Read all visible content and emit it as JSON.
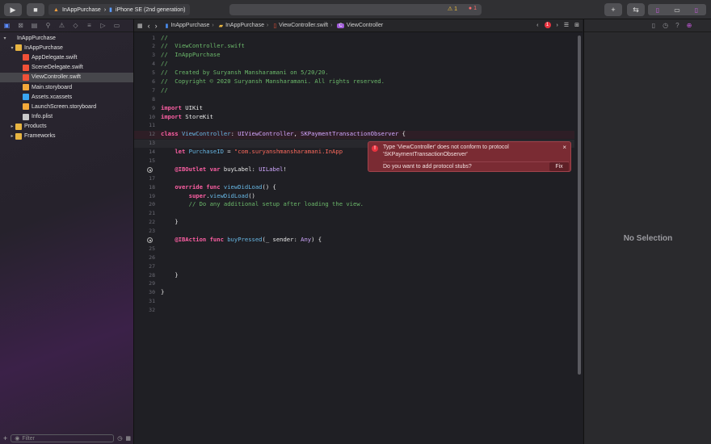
{
  "toolbar": {
    "run_icon": "play-icon",
    "stop_icon": "stop-icon",
    "scheme": "InAppPurchase",
    "device": "iPhone SE (2nd generation)",
    "warnings": "1",
    "errors": "1"
  },
  "navigator": {
    "items": [
      {
        "label": "InAppPurchase",
        "icon": "project",
        "depth": 0,
        "disclosure": "▾"
      },
      {
        "label": "InAppPurchase",
        "icon": "folder",
        "depth": 1,
        "disclosure": "▾"
      },
      {
        "label": "AppDelegate.swift",
        "icon": "swift",
        "depth": 2
      },
      {
        "label": "SceneDelegate.swift",
        "icon": "swift",
        "depth": 2
      },
      {
        "label": "ViewController.swift",
        "icon": "swift",
        "depth": 2,
        "selected": true
      },
      {
        "label": "Main.storyboard",
        "icon": "story",
        "depth": 2
      },
      {
        "label": "Assets.xcassets",
        "icon": "assets",
        "depth": 2
      },
      {
        "label": "LaunchScreen.storyboard",
        "icon": "story",
        "depth": 2
      },
      {
        "label": "Info.plist",
        "icon": "plist",
        "depth": 2
      },
      {
        "label": "Products",
        "icon": "folder",
        "depth": 1,
        "disclosure": "▸"
      },
      {
        "label": "Frameworks",
        "icon": "folder",
        "depth": 1,
        "disclosure": "▸"
      }
    ],
    "filter_placeholder": "Filter"
  },
  "jumpbar": {
    "crumbs": [
      "InAppPurchase",
      "InAppPurchase",
      "ViewController.swift",
      "ViewController"
    ],
    "error_count": "1"
  },
  "editor": {
    "lines": [
      [
        [
          "c",
          "//"
        ]
      ],
      [
        [
          "c",
          "//  ViewController.swift"
        ]
      ],
      [
        [
          "c",
          "//  InAppPurchase"
        ]
      ],
      [
        [
          "c",
          "//"
        ]
      ],
      [
        [
          "c",
          "//  Created by Suryansh Mansharamani on 5/20/20."
        ]
      ],
      [
        [
          "c",
          "//  Copyright © 2020 Suryansh Mansharamani. All rights reserved."
        ]
      ],
      [
        [
          "c",
          "//"
        ]
      ],
      [],
      [
        [
          "k",
          "import"
        ],
        [
          "p",
          " UIKit"
        ]
      ],
      [
        [
          "k",
          "import"
        ],
        [
          "p",
          " StoreKit"
        ]
      ],
      [],
      [
        [
          "k",
          "class"
        ],
        [
          "p",
          " "
        ],
        [
          "f",
          "ViewController"
        ],
        [
          "p",
          ": "
        ],
        [
          "t",
          "UIViewController"
        ],
        [
          "p",
          ", "
        ],
        [
          "t",
          "SKPaymentTransactionObserver"
        ],
        [
          "p",
          " {"
        ]
      ],
      [],
      [
        [
          "p",
          "    "
        ],
        [
          "k",
          "let"
        ],
        [
          "p",
          " "
        ],
        [
          "f",
          "PurchaseID"
        ],
        [
          "p",
          " = "
        ],
        [
          "s",
          "\"com.suryanshmansharamani.InApp"
        ]
      ],
      [],
      [
        [
          "p",
          "    "
        ],
        [
          "k",
          "@IBOutlet"
        ],
        [
          "p",
          " "
        ],
        [
          "k",
          "var"
        ],
        [
          "p",
          " buyLabel: "
        ],
        [
          "t",
          "UILabel"
        ],
        [
          "p",
          "!"
        ]
      ],
      [],
      [
        [
          "p",
          "    "
        ],
        [
          "k",
          "override"
        ],
        [
          "p",
          " "
        ],
        [
          "k",
          "func"
        ],
        [
          "p",
          " "
        ],
        [
          "f",
          "viewDidLoad"
        ],
        [
          "p",
          "() {"
        ]
      ],
      [
        [
          "p",
          "        "
        ],
        [
          "k",
          "super"
        ],
        [
          "p",
          "."
        ],
        [
          "f",
          "viewDidLoad"
        ],
        [
          "p",
          "()"
        ]
      ],
      [
        [
          "c",
          "        // Do any additional setup after loading the view."
        ]
      ],
      [],
      [
        [
          "p",
          "    }"
        ]
      ],
      [],
      [
        [
          "p",
          "    "
        ],
        [
          "k",
          "@IBAction"
        ],
        [
          "p",
          " "
        ],
        [
          "k",
          "func"
        ],
        [
          "p",
          " "
        ],
        [
          "f",
          "buyPressed"
        ],
        [
          "p",
          "(_ sender: "
        ],
        [
          "t",
          "Any"
        ],
        [
          "p",
          ") {"
        ]
      ],
      [],
      [],
      [],
      [
        [
          "p",
          "    }"
        ]
      ],
      [],
      [
        [
          "p",
          "}"
        ]
      ],
      [],
      []
    ]
  },
  "error_popup": {
    "message": "Type 'ViewController' does not conform to protocol 'SKPaymentTransactionObserver'",
    "suggestion": "Do you want to add protocol stubs?",
    "fix_label": "Fix",
    "close": "×"
  },
  "inspector": {
    "empty_label": "No Selection"
  }
}
